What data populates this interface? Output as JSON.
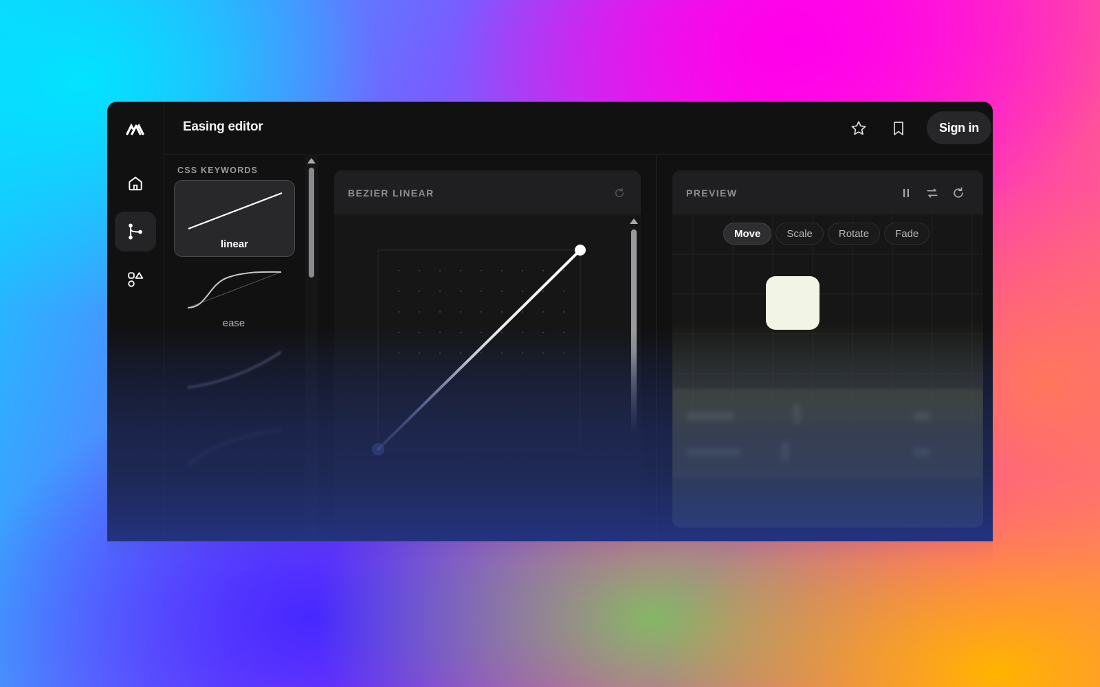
{
  "app": {
    "title": "Easing editor",
    "sign_in_label": "Sign in"
  },
  "rail": {
    "items": [
      {
        "name": "home",
        "icon": "home-icon"
      },
      {
        "name": "curves",
        "icon": "branch-icon",
        "active": true
      },
      {
        "name": "shapes",
        "icon": "shapes-icon"
      }
    ]
  },
  "keywords": {
    "section_label": "CSS KEYWORDS",
    "items": [
      {
        "label": "linear",
        "active": true
      },
      {
        "label": "ease",
        "active": false
      },
      {
        "label": "",
        "active": false
      },
      {
        "label": "",
        "active": false
      }
    ]
  },
  "bezier": {
    "title": "BEZIER LINEAR",
    "reset_icon": "refresh-icon"
  },
  "preview": {
    "title": "PREVIEW",
    "tabs": [
      "Move",
      "Scale",
      "Rotate",
      "Fade"
    ],
    "active_tab": "Move",
    "controls": [
      "pause-icon",
      "repeat-icon",
      "refresh-icon"
    ]
  },
  "colors": {
    "window_bg": "#111112",
    "panel_bg": "#161617",
    "accent_square": "#f2f5e6"
  }
}
